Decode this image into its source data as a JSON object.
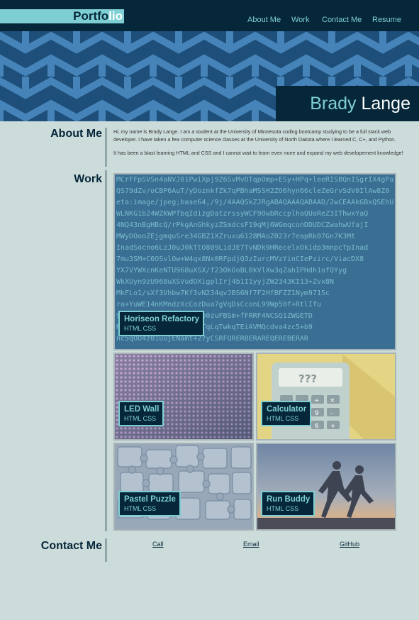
{
  "header": {
    "logo": {
      "main": "Portfo",
      "accent": "lio"
    },
    "nav": [
      {
        "label": "About Me"
      },
      {
        "label": "Work"
      },
      {
        "label": "Contact Me"
      },
      {
        "label": "Resume"
      }
    ]
  },
  "hero": {
    "name_first": "Brady",
    "name_last": "Lange"
  },
  "about": {
    "title": "About Me",
    "paragraphs": [
      "Hi, my name is Brady Lange. I am a student at the University of Minnesota coding bootcamp studying to be a full stack web developer. I have taken a few computer science classes at the University of North Dakota where I learned C, C+, and Python.",
      "It has been a blast learning HTML and CSS and I cannot wait to learn even more and expand my web developement knowledge!"
    ]
  },
  "work": {
    "title": "Work",
    "projects": [
      {
        "title": "Horiseon Refactory",
        "tags": "HTML CSS"
      },
      {
        "title": "LED Wall",
        "tags": "HTML CSS"
      },
      {
        "title": "Calculator",
        "tags": "HTML CSS"
      },
      {
        "title": "Pastel Puzzle",
        "tags": "HTML CSS"
      },
      {
        "title": "Run Buddy",
        "tags": "HTML CSS"
      }
    ],
    "code_lines": [
      "MCrFFpSVSn4aNVJ01PwiXpj9Z6SvMvDTqpOmp+ESy+HPq+leeRISBQnISgrIX4gPa",
      "QS79dZv/oCBP6AuT/yDoznkfZk7qPBhaMSSH2ZO6hyn66cleZeGrvSdV0IlAw8Z0",
      "eta:image/jpeg;base64,/9j/4AAQSkZJRgABAQAAAQABAAD/2wCEAAkGBxQSEhU",
      "WLNKG1b24WZKWPfbqIdizgDatzrssyWCF9OwbRccplhaQUoReZ3IThwxYaQ",
      "4NQ43nBgHBcQ/rPkgAnGhkyzZSmdcsF19qMj6WGmqconDDUDCZwahwUfajI",
      "MWyDOooZEjgmquSre34GBZ1XZruxu6128MAoZ023r7eapRk07Gn7K3Mt",
      "InadSocno6LzJ0uJ0kTtO809LidJE7TvNDk9HRecelxOkidp3mnpcTpInad",
      "7mu3SM+C6OSvlOw+W4qx8Nx0RFpdjQ3zIurcMVzYinCIePzirc/ViacDX8",
      "YX7VYWXcnKeNTU968uXSX/f23OkOoBL0kVlXw3qZahIPHdh1ofQYyg",
      "WkXUyn9zU968uXSVudOXigplIrj4b1I1yyjZW2343KI13+Zvx8N",
      "MkFLo1/sXf3Vhbw7Kf3vN234qvJBS6Nf7F2HfBFZZ1Nym971Sc",
      "ra+YuWE14nKMndzXcCozDua7gVqDsCconL99Wp50f+RtlIfu",
      "9RtHd0pGV4FJDfBABREDp0zuFBSm+fFRRF4NCSQ1ZWGETD",
      "RzmtANDLmA0MDtIGWXPgTqLqTwkqTEiAVMQcdva4zc5+b9",
      "nc5qOU4z01uujENamt+27yCSRFQRERBERAREQEREBERAR"
    ]
  },
  "contact": {
    "title": "Contact Me",
    "links": [
      {
        "label": "Call"
      },
      {
        "label": "Email"
      },
      {
        "label": "GitHub"
      }
    ]
  },
  "colors": {
    "navy": "#06273a",
    "teal": "#7ecfd3",
    "background": "#ccdcdb",
    "pattern": "#3b78ad"
  }
}
